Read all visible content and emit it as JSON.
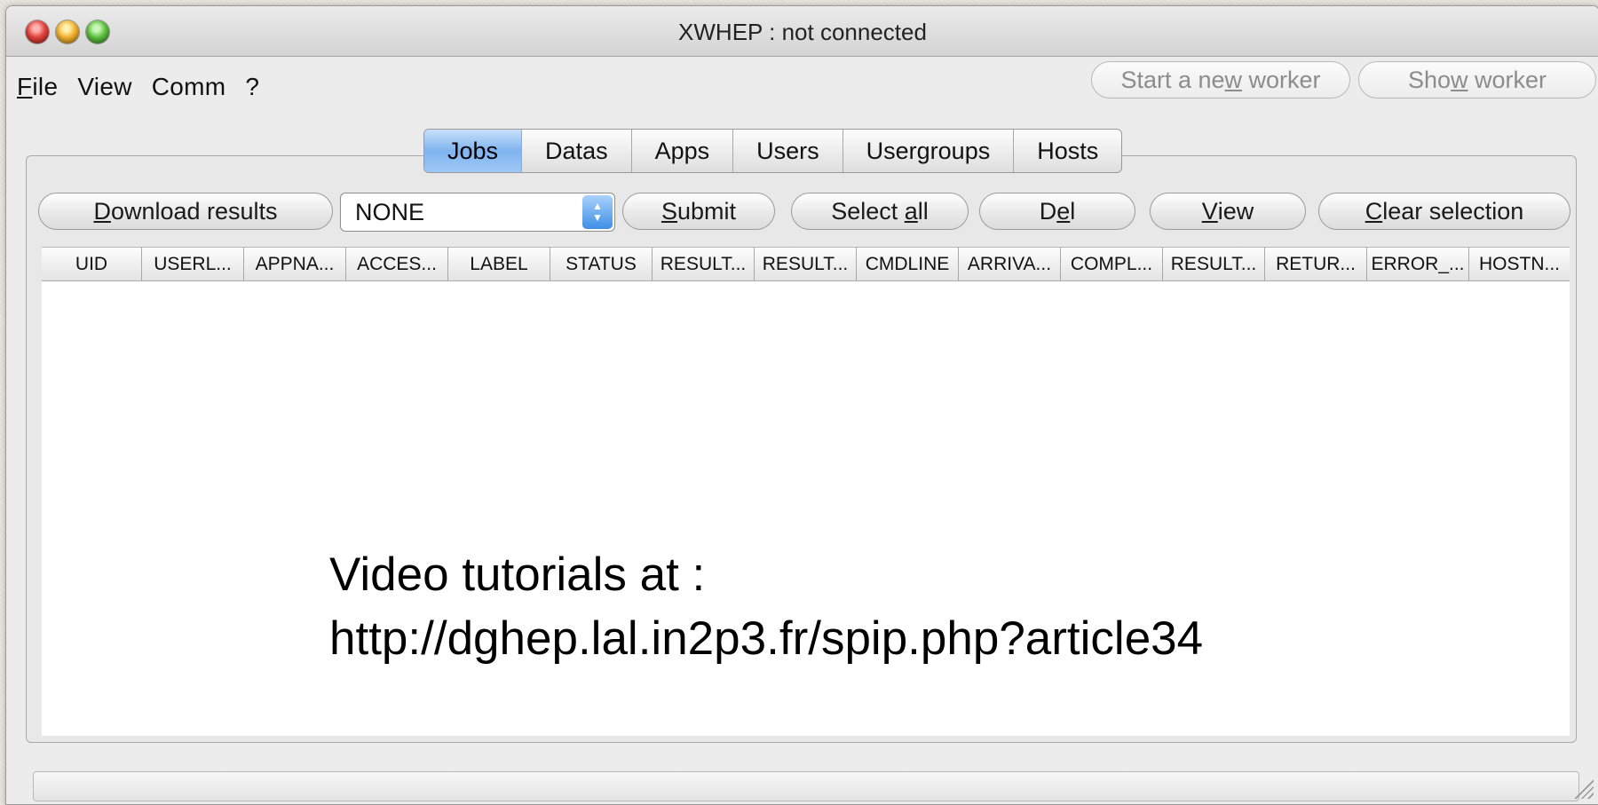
{
  "window": {
    "title": "XWHEP : not connected"
  },
  "menubar": {
    "items": [
      "File",
      "View",
      "Comm",
      "?"
    ]
  },
  "toolbar_top": {
    "start_worker": "Start a new worker",
    "show_worker": "Show worker"
  },
  "tabs": [
    {
      "label": "Jobs",
      "active": true
    },
    {
      "label": "Datas",
      "active": false
    },
    {
      "label": "Apps",
      "active": false
    },
    {
      "label": "Users",
      "active": false
    },
    {
      "label": "Usergroups",
      "active": false
    },
    {
      "label": "Hosts",
      "active": false
    }
  ],
  "actions": {
    "download": "Download results",
    "select_value": "NONE",
    "submit": "Submit",
    "select_all": "Select all",
    "del": "Del",
    "view": "View",
    "clear": "Clear selection"
  },
  "table": {
    "columns": [
      "UID",
      "USERL...",
      "APPNA...",
      "ACCES...",
      "LABEL",
      "STATUS",
      "RESULT...",
      "RESULT...",
      "CMDLINE",
      "ARRIVA...",
      "COMPL...",
      "RESULT...",
      "RETUR...",
      "ERROR_...",
      "HOSTN..."
    ]
  },
  "overlay": {
    "line1": "Video tutorials at :",
    "line2": "http://dghep.lal.in2p3.fr/spip.php?article34"
  },
  "colors": {
    "tab_active": "#7fb4ef",
    "window_bg": "#ececec"
  }
}
